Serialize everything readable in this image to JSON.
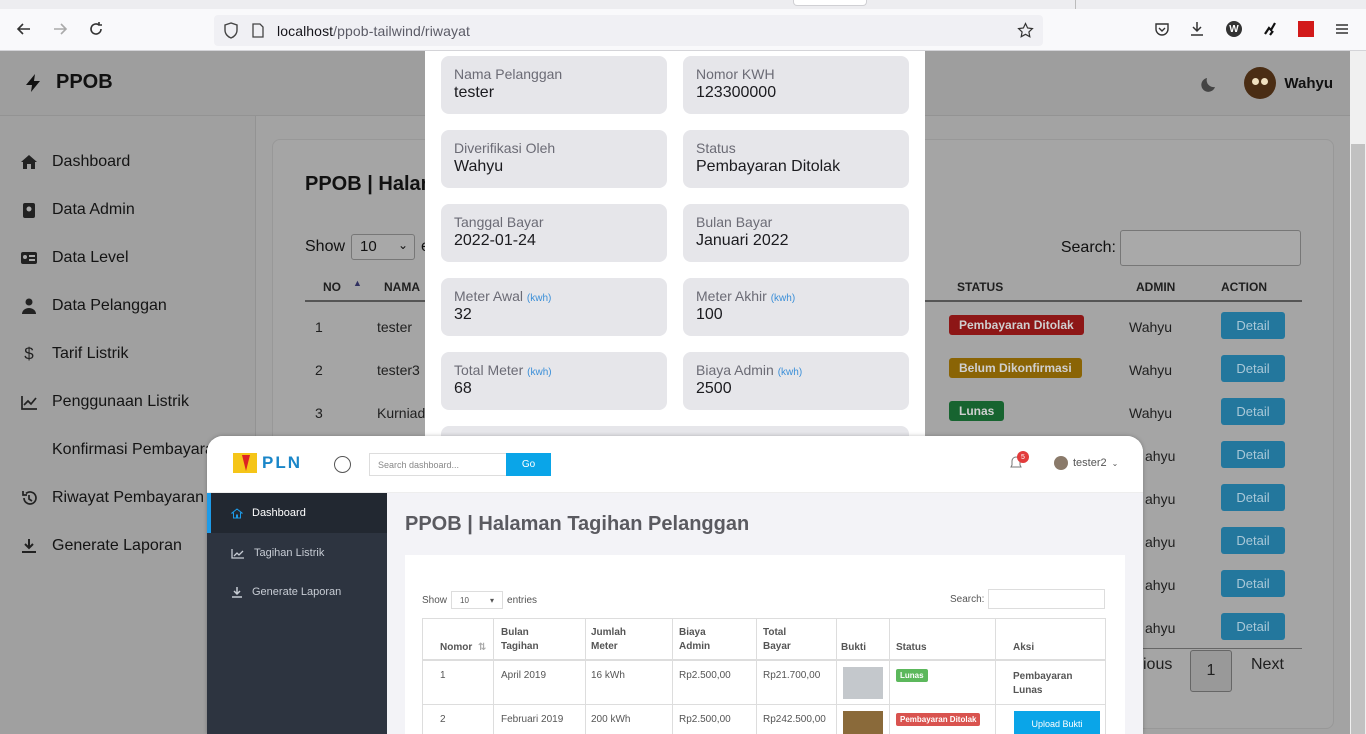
{
  "browser": {
    "url_host": "localhost",
    "url_path": "/ppob-tailwind/riwayat"
  },
  "app": {
    "brand": "PPOB",
    "user_name": "Wahyu",
    "sidebar": [
      "Dashboard",
      "Data Admin",
      "Data Level",
      "Data Pelanggan",
      "Tarif Listrik",
      "Penggunaan Listrik",
      "Konfirmasi Pembayaran",
      "Riwayat Pembayaran",
      "Generate Laporan"
    ],
    "page_title": "PPOB | Halaman",
    "show_label": "Show",
    "show_value": "10",
    "show_suffix": "e",
    "search_label": "Search:",
    "columns": {
      "no": "NO",
      "nama": "NAMA",
      "status": "STATUS",
      "admin": "ADMIN",
      "action": "ACTION"
    },
    "rows": [
      {
        "no": "1",
        "nama": "tester",
        "status": "Pembayaran Ditolak",
        "status_color": "#b01d1d",
        "admin": "Wahyu",
        "action": "Detail"
      },
      {
        "no": "2",
        "nama": "tester3",
        "status": "Belum Dikonfirmasi",
        "status_color": "#a87a06",
        "admin": "Wahyu",
        "action": "Detail"
      },
      {
        "no": "3",
        "nama": "Kurniad",
        "status": "Lunas",
        "status_color": "#1d7a3a",
        "admin": "Wahyu",
        "action": "Detail"
      },
      {
        "admin": "ahyu",
        "action": "Detail"
      },
      {
        "admin": "ahyu",
        "action": "Detail"
      },
      {
        "admin": "ahyu",
        "action": "Detail"
      },
      {
        "admin": "ahyu",
        "action": "Detail"
      },
      {
        "admin": "ahyu",
        "action": "Detail"
      }
    ],
    "pager": {
      "prev": "ious",
      "page": "1",
      "next": "Next"
    }
  },
  "modal": {
    "fields": [
      {
        "label": "Nama Pelanggan",
        "value": "tester"
      },
      {
        "label": "Nomor KWH",
        "value": "123300000"
      },
      {
        "label": "Diverifikasi Oleh",
        "value": "Wahyu"
      },
      {
        "label": "Status",
        "value": "Pembayaran Ditolak"
      },
      {
        "label": "Tanggal Bayar",
        "value": "2022-01-24"
      },
      {
        "label": "Bulan Bayar",
        "value": "Januari 2022"
      },
      {
        "label": "Meter Awal",
        "unit": "(kwh)",
        "value": "32"
      },
      {
        "label": "Meter Akhir",
        "unit": "(kwh)",
        "value": "100"
      },
      {
        "label": "Total Meter",
        "unit": "(kwh)",
        "value": "68"
      },
      {
        "label": "Biaya Admin",
        "unit": "(kwh)",
        "value": "2500"
      }
    ]
  },
  "front": {
    "brand": "PLN",
    "search_placeholder": "Search dashboard...",
    "go": "Go",
    "notif_count": "5",
    "user": "tester2",
    "sidebar": [
      "Dashboard",
      "Tagihan Listrik",
      "Generate Laporan"
    ],
    "title": "PPOB | Halaman Tagihan Pelanggan",
    "show_label": "Show",
    "show_value": "10",
    "entries": "entries",
    "search_label": "Search:",
    "headers": {
      "nomor": "Nomor",
      "bulan": "Bulan Tagihan",
      "jumlah": "Jumlah Meter",
      "biaya": "Biaya Admin",
      "total": "Total Bayar",
      "bukti": "Bukti",
      "status": "Status",
      "aksi": "Aksi"
    },
    "rows": [
      {
        "nomor": "1",
        "bulan": "April 2019",
        "jumlah": "16 kWh",
        "biaya": "Rp2.500,00",
        "total": "Rp21.700,00",
        "status": "Lunas",
        "status_color": "#5cb85c",
        "aksi": "Pembayaran Lunas"
      },
      {
        "nomor": "2",
        "bulan": "Februari 2019",
        "jumlah": "200 kWh",
        "biaya": "Rp2.500,00",
        "total": "Rp242.500,00",
        "status": "Pembayaran Ditolak",
        "status_color": "#d9534f",
        "aksi": "Upload Bukti"
      }
    ]
  }
}
